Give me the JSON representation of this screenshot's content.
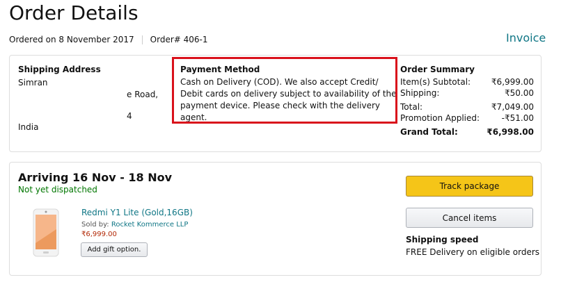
{
  "page": {
    "title": "Order Details",
    "ordered_on": "Ordered on 8 November 2017",
    "order_number": "Order# 406-1",
    "invoice_label": "Invoice"
  },
  "shipping": {
    "heading": "Shipping Address",
    "name": "Simran",
    "line1": "e Road,",
    "line2": "4",
    "country": "India"
  },
  "payment": {
    "heading": "Payment Method",
    "text": "Cash on Delivery (COD). We also accept Credit/ Debit cards on delivery subject to availability of the payment device. Please check with the delivery agent."
  },
  "summary": {
    "heading": "Order Summary",
    "rows": [
      {
        "label": "Item(s) Subtotal:",
        "value": "₹6,999.00"
      },
      {
        "label": "Shipping:",
        "value": "₹50.00"
      },
      {
        "label": "Total:",
        "value": "₹7,049.00"
      },
      {
        "label": "Promotion Applied:",
        "value": "-₹51.00"
      }
    ],
    "grand_total_label": "Grand Total:",
    "grand_total_value": "₹6,998.00"
  },
  "shipment": {
    "arriving": "Arriving 16 Nov - 18 Nov",
    "status": "Not yet dispatched",
    "product_name": "Redmi Y1 Lite (Gold,16GB)",
    "sold_by_label": "Sold by: ",
    "seller": "Rocket Kommerce LLP",
    "price": "₹6,999.00",
    "gift_option_label": "Add gift option.",
    "track_label": "Track package",
    "cancel_label": "Cancel items",
    "shipping_speed_heading": "Shipping speed",
    "shipping_speed_text": "FREE Delivery on eligible orders"
  },
  "colors": {
    "link": "#0f7685",
    "status_green": "#007600",
    "price_red": "#b12704",
    "highlight_red": "#d9111b",
    "track_button": "#f5c518"
  }
}
